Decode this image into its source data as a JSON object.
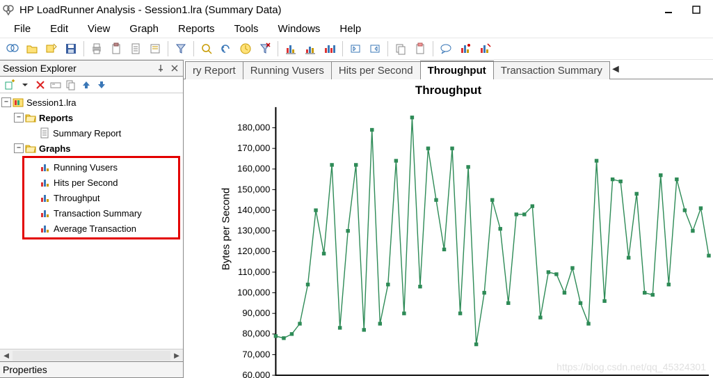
{
  "title": "HP LoadRunner Analysis - Session1.lra (Summary Data)",
  "menus": [
    "File",
    "Edit",
    "View",
    "Graph",
    "Reports",
    "Tools",
    "Windows",
    "Help"
  ],
  "session_explorer": {
    "label": "Session Explorer",
    "tree": {
      "root": "Session1.lra",
      "reports_label": "Reports",
      "reports": [
        "Summary Report"
      ],
      "graphs_label": "Graphs",
      "graphs": [
        "Running Vusers",
        "Hits per Second",
        "Throughput",
        "Transaction Summary",
        "Average Transaction"
      ]
    }
  },
  "properties": {
    "label": "Properties"
  },
  "tabs": [
    "ry Report",
    "Running Vusers",
    "Hits per Second",
    "Throughput",
    "Transaction Summary"
  ],
  "active_tab": "Throughput",
  "watermark": "https://blog.csdn.net/qq_45324301",
  "chart_data": {
    "type": "line",
    "title": "Throughput",
    "ylabel": "Bytes per Second",
    "xlabel": "",
    "ylim": [
      60000,
      190000
    ],
    "yticks": [
      60000,
      70000,
      80000,
      90000,
      100000,
      110000,
      120000,
      130000,
      140000,
      150000,
      160000,
      170000,
      180000
    ],
    "ytick_labels": [
      "60,000",
      "70,000",
      "80,000",
      "90,000",
      "100,000",
      "110,000",
      "120,000",
      "130,000",
      "140,000",
      "150,000",
      "160,000",
      "170,000",
      "180,000"
    ],
    "series": [
      {
        "name": "Throughput",
        "color": "#2e8b57",
        "values": [
          79000,
          78000,
          80000,
          85000,
          104000,
          140000,
          119000,
          162000,
          83000,
          130000,
          162000,
          82000,
          179000,
          85000,
          104000,
          164000,
          90000,
          185000,
          103000,
          170000,
          145000,
          121000,
          170000,
          90000,
          161000,
          75000,
          100000,
          145000,
          131000,
          95000,
          138000,
          138000,
          142000,
          88000,
          110000,
          109000,
          100000,
          112000,
          95000,
          85000,
          164000,
          96000,
          155000,
          154000,
          117000,
          148000,
          100000,
          99000,
          157000,
          104000,
          155000,
          140000,
          130000,
          141000,
          118000
        ]
      }
    ]
  }
}
